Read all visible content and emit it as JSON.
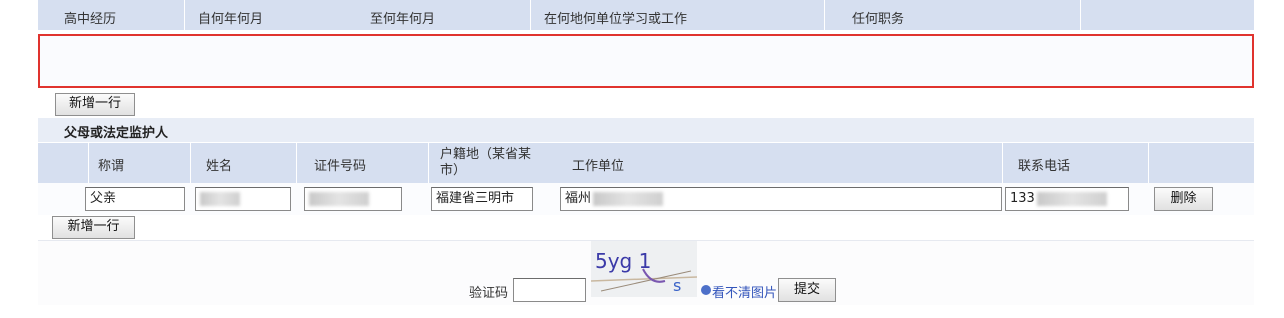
{
  "work_history": {
    "columns": [
      "高中经历",
      "自何年何月",
      "至何年何月",
      "在何地何单位学习或工作",
      "任何职务"
    ],
    "add_row_label": "新增一行"
  },
  "guardians": {
    "section_title": "父母或法定监护人",
    "columns": [
      "称谓",
      "姓名",
      "证件号码",
      "户籍地（某省某市）",
      "工作单位",
      "联系电话"
    ],
    "row": {
      "relation": "父亲",
      "household": "福建省三明市",
      "employer_prefix": "福州",
      "phone_prefix": "133"
    },
    "delete_label": "删除",
    "add_row_label": "新增一行"
  },
  "captcha": {
    "label": "验证码",
    "image_text": "5yg 1",
    "refresh_link": "看不清图片",
    "submit_label": "提交"
  }
}
